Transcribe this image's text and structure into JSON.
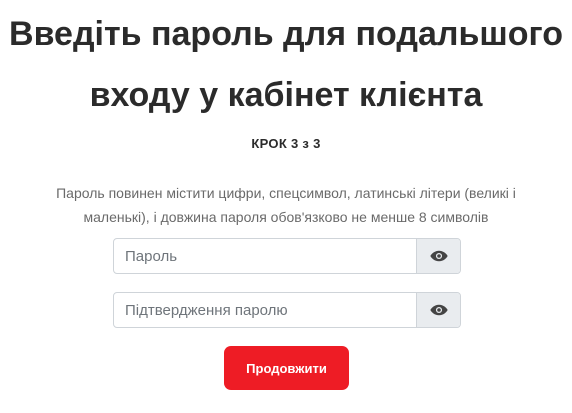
{
  "heading": {
    "line1": "Введіть пароль для подальшого",
    "line2": "входу у кабінет клієнта"
  },
  "step_label": "КРОК 3 з 3",
  "hint": {
    "line1": "Пароль повинен містити цифри, спецсимвол, латинські літери (великі і",
    "line2": "маленькі), і довжина пароля обов'язково не менше 8 символів"
  },
  "form": {
    "password": {
      "placeholder": "Пароль",
      "value": "",
      "toggle_icon": "eye-icon"
    },
    "confirm": {
      "placeholder": "Підтвердження паролю",
      "value": "",
      "toggle_icon": "eye-icon"
    },
    "submit_label": "Продовжити"
  },
  "colors": {
    "accent": "#ee1c25",
    "toggle_bg": "#e9ecef",
    "heading": "#2b2b2b",
    "hint": "#6a6a6a"
  }
}
